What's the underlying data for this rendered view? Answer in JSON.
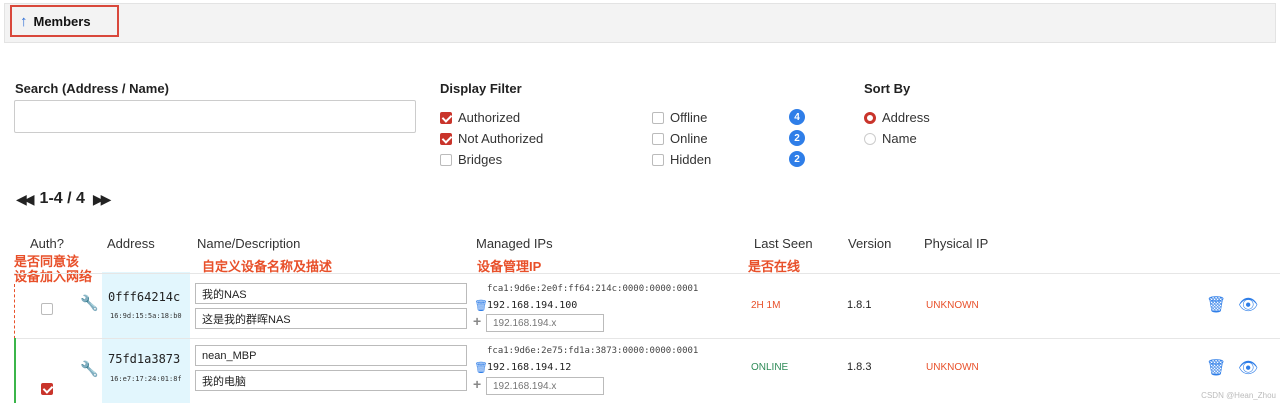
{
  "header": {
    "title": "Members"
  },
  "search": {
    "label": "Search (Address / Name)",
    "value": ""
  },
  "display_filter": {
    "label": "Display Filter",
    "options": [
      {
        "label": "Authorized",
        "checked": true
      },
      {
        "label": "Not Authorized",
        "checked": true
      },
      {
        "label": "Bridges",
        "checked": false
      },
      {
        "label": "Offline",
        "checked": false,
        "count": "4"
      },
      {
        "label": "Online",
        "checked": false,
        "count": "2"
      },
      {
        "label": "Hidden",
        "checked": false,
        "count": "2"
      }
    ]
  },
  "sort_by": {
    "label": "Sort By",
    "options": [
      {
        "label": "Address",
        "selected": true
      },
      {
        "label": "Name",
        "selected": false
      }
    ]
  },
  "pager": {
    "range": "1-4 / 4"
  },
  "columns": {
    "auth": "Auth?",
    "address": "Address",
    "name": "Name/Description",
    "ips": "Managed IPs",
    "last_seen": "Last Seen",
    "version": "Version",
    "physical_ip": "Physical IP"
  },
  "annotations": {
    "auth_line1": "是否同意该",
    "auth_line2": "设备加入网络",
    "name": "自定义设备名称及描述",
    "ips": "设备管理IP",
    "last_seen": "是否在线"
  },
  "members": [
    {
      "authorized": false,
      "address": "0fff64214c",
      "mac": "16:9d:15:5a:18:b0",
      "name": "我的NAS",
      "description": "这是我的群晖NAS",
      "ipv6": "fca1:9d6e:2e0f:ff64:214c:0000:0000:0001",
      "ipv4": "192.168.194.100",
      "ip_placeholder": "192.168.194.x",
      "last_seen": "2H 1M",
      "version": "1.8.1",
      "physical_ip": "UNKNOWN"
    },
    {
      "authorized": true,
      "address": "75fd1a3873",
      "mac": "16:e7:17:24:01:8f",
      "name": "nean_MBP",
      "description": "我的电脑",
      "ipv6": "fca1:9d6e:2e75:fd1a:3873:0000:0000:0001",
      "ipv4": "192.168.194.12",
      "ip_placeholder": "192.168.194.x",
      "last_seen": "ONLINE",
      "version": "1.8.3",
      "physical_ip": "UNKNOWN"
    }
  ],
  "colors": {
    "accent": "#2f7ee8",
    "check": "#c9342b",
    "annotation": "#e8502a",
    "online": "#2e8b57",
    "offline": "#e8502a"
  },
  "watermark": "CSDN @Hean_Zhou"
}
